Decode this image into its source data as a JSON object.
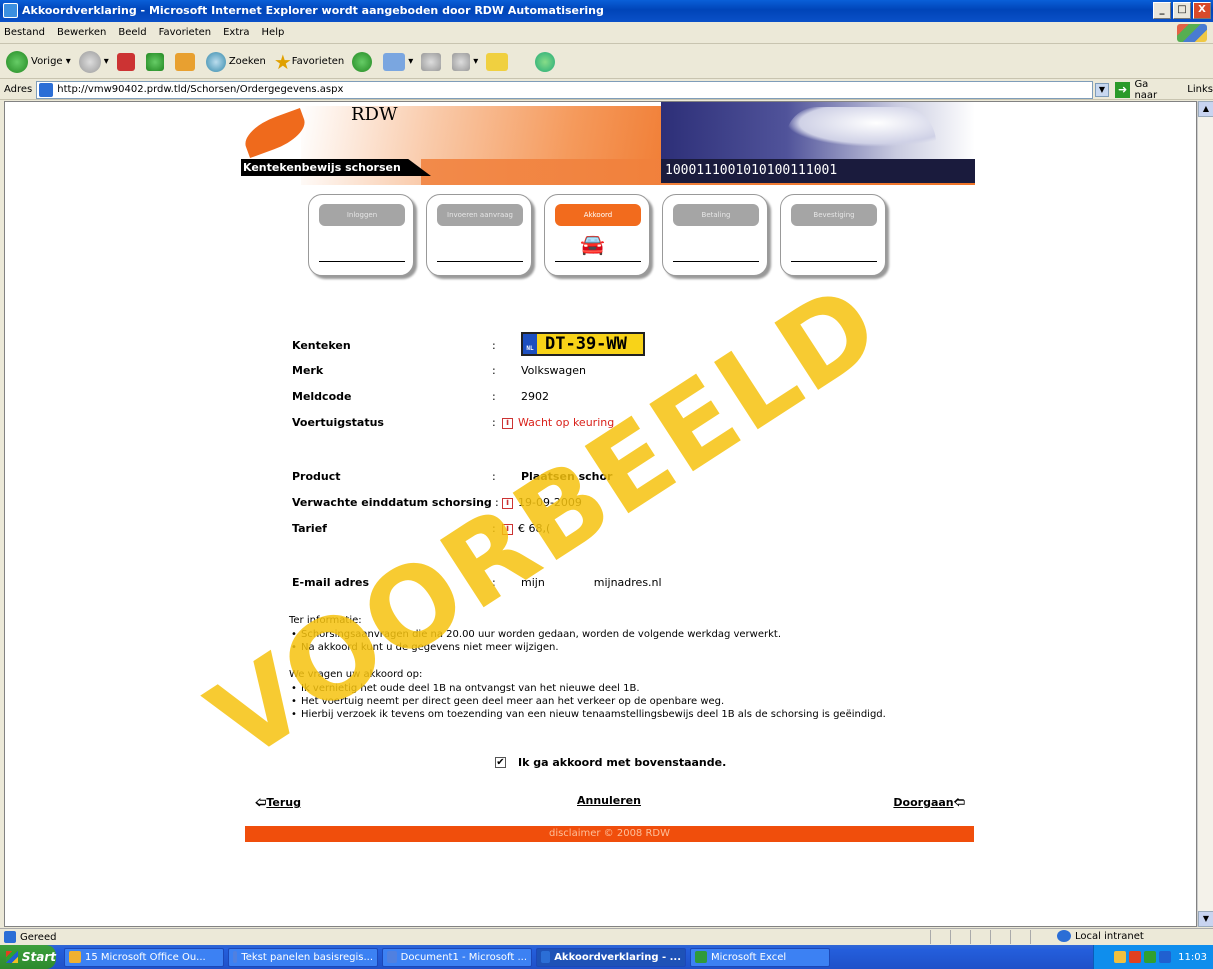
{
  "window": {
    "title": "Akkoordverklaring - Microsoft Internet Explorer wordt aangeboden door RDW Automatisering",
    "controls": [
      "_",
      "□",
      "X"
    ]
  },
  "menu": [
    "Bestand",
    "Bewerken",
    "Beeld",
    "Favorieten",
    "Extra",
    "Help"
  ],
  "toolbar": {
    "back": "Vorige",
    "search": "Zoeken",
    "favorites": "Favorieten"
  },
  "address": {
    "label": "Adres",
    "url": "http://vmw90402.prdw.tld/Schorsen/Ordergegevens.aspx",
    "go": "Ga naar",
    "links": "Links"
  },
  "banner": {
    "brand": "RDW",
    "title": "Kentekenbewijs schorsen",
    "binary": "1000111001010100111001"
  },
  "steps": [
    {
      "label": "Inloggen",
      "active": false
    },
    {
      "label": "Invoeren aanvraag",
      "active": false
    },
    {
      "label": "Akkoord",
      "active": true
    },
    {
      "label": "Betaling",
      "active": false
    },
    {
      "label": "Bevestiging",
      "active": false
    }
  ],
  "fields": {
    "sep": ":",
    "kenteken": {
      "label": "Kenteken",
      "value": "DT-39-WW",
      "country": "NL"
    },
    "merk": {
      "label": "Merk",
      "value": "Volkswagen"
    },
    "meldcode": {
      "label": "Meldcode",
      "value": "2902"
    },
    "status": {
      "label": "Voertuigstatus",
      "value": "Wacht op keuring"
    },
    "product": {
      "label": "Product",
      "value": "Plaatsen schor"
    },
    "einddatum": {
      "label": "Verwachte einddatum schorsing",
      "value": "19-09-2009"
    },
    "tarief": {
      "label": "Tarief",
      "value": "€ 68,("
    },
    "email": {
      "label": "E-mail adres",
      "value": "mijn              mijnadres.nl"
    }
  },
  "info_icon": "i",
  "notes": {
    "heading1": "Ter informatie:",
    "items1": [
      "Schorsingsaanvragen die na 20.00 uur worden gedaan, worden de volgende werkdag verwerkt.",
      "Na akkoord kunt u de gegevens niet meer wijzigen."
    ],
    "heading2": "We vragen uw akkoord op:",
    "items2": [
      "Ik vernietig het oude deel 1B na ontvangst van het nieuwe deel 1B.",
      "Het voertuig neemt per direct geen deel meer aan het verkeer op de openbare weg.",
      "Hierbij verzoek ik tevens om toezending van een nieuw tenaamstellingsbewijs deel 1B als de schorsing is geëindigd."
    ]
  },
  "agree": {
    "label": "Ik ga akkoord met bovenstaande.",
    "checked": "✔"
  },
  "nav": {
    "back": "Terug",
    "cancel": "Annuleren",
    "next": "Doorgaan"
  },
  "footer": "disclaimer    © 2008 RDW",
  "watermark": "VOORBEELD",
  "status": {
    "text": "Gereed",
    "zone": "Local intranet"
  },
  "taskbar": {
    "start": "Start",
    "items": [
      {
        "label": "15 Microsoft Office Ou...",
        "active": false
      },
      {
        "label": "Tekst panelen basisregis...",
        "active": false
      },
      {
        "label": "Document1 - Microsoft ...",
        "active": false
      },
      {
        "label": "Akkoordverklaring - ...",
        "active": true
      },
      {
        "label": "Microsoft Excel",
        "active": false
      }
    ],
    "clock": "11:03"
  },
  "colors": {
    "accent": "#f04e0c",
    "watermark": "#f6c30f",
    "status_red": "#d9221b",
    "plate": "#f8d318"
  }
}
